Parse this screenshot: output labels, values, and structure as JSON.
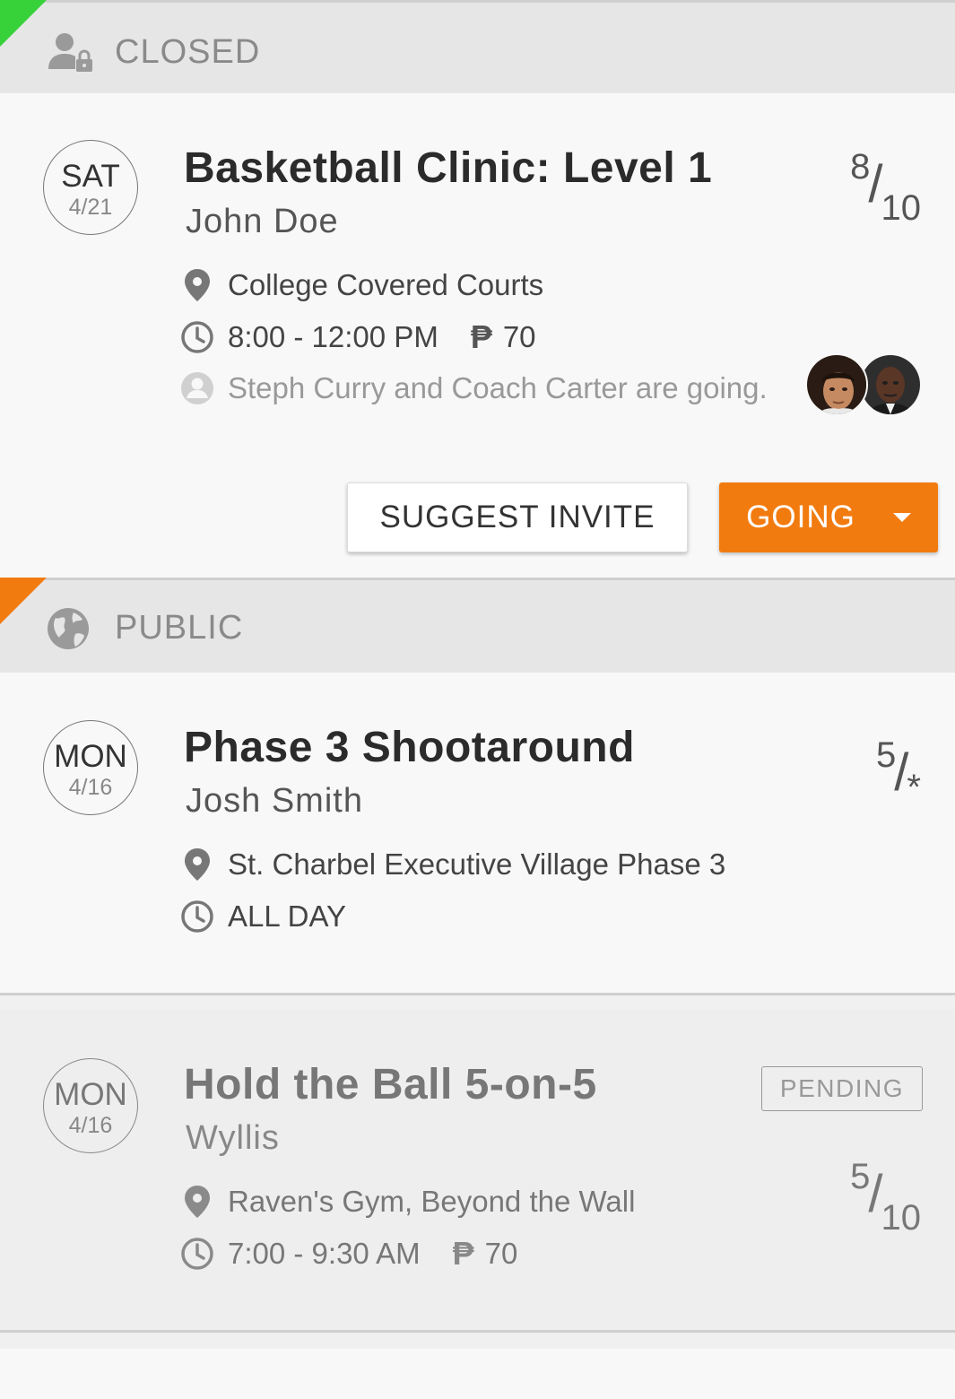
{
  "sections": [
    {
      "label": "CLOSED",
      "icon": "user-lock-icon",
      "corner_color": "#37d13a"
    },
    {
      "label": "PUBLIC",
      "icon": "globe-icon",
      "corner_color": "#f27b0f"
    }
  ],
  "events": [
    {
      "day": "SAT",
      "date": "4/21",
      "title": "Basketball Clinic: Level 1",
      "host": "John Doe",
      "location": "College Covered Courts",
      "time": "8:00 - 12:00 PM",
      "currency": "₱",
      "price": "70",
      "attendees_text": "Steph Curry and Coach Carter are going.",
      "count_going": "8",
      "count_total": "10",
      "actions": {
        "suggest_invite": "SUGGEST INVITE",
        "going": "GOING"
      }
    },
    {
      "day": "MON",
      "date": "4/16",
      "title": "Phase 3 Shootaround",
      "host": "Josh Smith",
      "location": "St. Charbel Executive Village Phase 3",
      "time": "ALL DAY",
      "count_going": "5",
      "count_total": "*"
    },
    {
      "day": "MON",
      "date": "4/16",
      "title": "Hold the Ball 5-on-5",
      "host": "Wyllis",
      "location": "Raven's Gym, Beyond the Wall",
      "time": "7:00 - 9:30 AM",
      "currency": "₱",
      "price": "70",
      "status": "PENDING",
      "count_going": "5",
      "count_total": "10"
    }
  ],
  "colors": {
    "accent_orange": "#f27b0f",
    "closed_green": "#37d13a"
  }
}
